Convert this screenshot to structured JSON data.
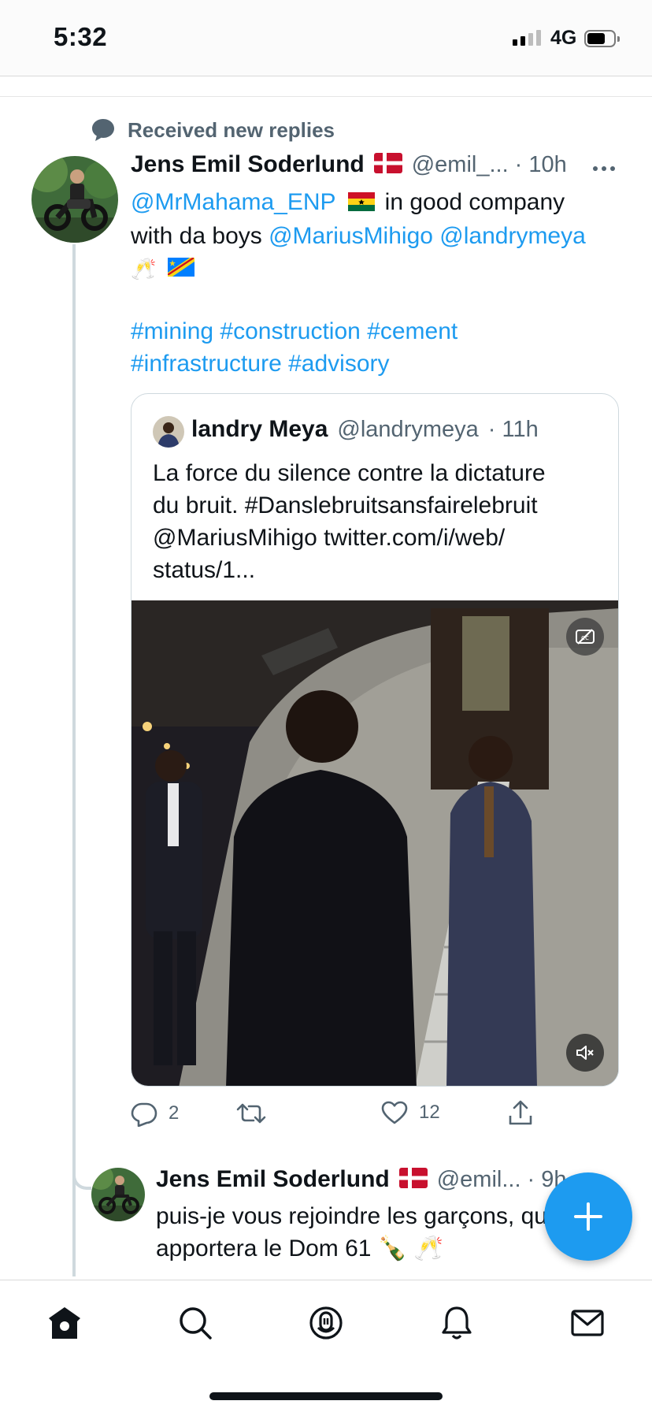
{
  "status_bar": {
    "time": "5:32",
    "network": "4G",
    "signal_bars": 2,
    "battery_level": 0.6
  },
  "social_context": {
    "text": "Received new replies",
    "icon": "reply-bubble-icon"
  },
  "main_tweet": {
    "name": "Jens Emil Soderlund",
    "flag": "denmark-flag",
    "handle": "@emil_...",
    "time": "· 10h",
    "mention_1": "@MrMahama_ENP",
    "flag_ghana": "ghana-flag",
    "text_1": " in good company",
    "text_2": "with da boys ",
    "mention_2": "@MariusMihigo",
    "mention_3": "@landrymeya",
    "emoji_line": "🥂",
    "flag_drc": "drc-flag",
    "hashtag_1": "#mining",
    "hashtag_2": "#construction",
    "hashtag_3": "#cement",
    "hashtag_4": "#infrastructure",
    "hashtag_5": "#advisory"
  },
  "quoted_tweet": {
    "name": "landry Meya",
    "handle": "@landrymeya",
    "time": "· 11h",
    "text_1": "La force du silence contre la dictature",
    "text_2": "du bruit. #Danslebruitsansfairelebruit",
    "text_3": "@MariusMihigo twitter.com/i/web/",
    "text_4": "status/1...",
    "media": "video-thumbnail"
  },
  "actions": {
    "reply_count": "2",
    "retweet_count": "",
    "like_count": "12"
  },
  "reply_tweet": {
    "name": "Jens Emil Soderlund",
    "handle": "@emil...",
    "time": "· 9h",
    "text_1": "puis-je vous rejoindre les garçons, qui",
    "text_2": "apportera le Dom 61 🍾 🥂"
  },
  "bottom_nav": [
    {
      "name": "home",
      "icon": "home-icon",
      "active": true
    },
    {
      "name": "search",
      "icon": "search-icon"
    },
    {
      "name": "spaces",
      "icon": "spaces-icon"
    },
    {
      "name": "notifications",
      "icon": "bell-icon"
    },
    {
      "name": "messages",
      "icon": "mail-icon"
    }
  ],
  "colors": {
    "accent": "#1d9bf0",
    "text": "#0f1419",
    "secondary": "#536471",
    "thread": "#cfd9de"
  }
}
